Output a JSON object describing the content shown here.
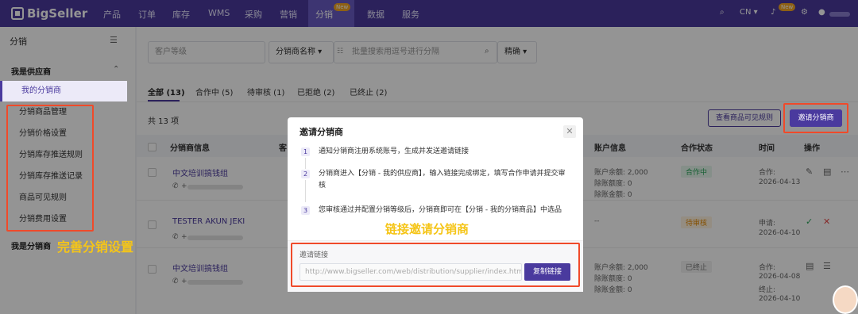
{
  "nav": {
    "logo": "BigSeller",
    "items": [
      "产品",
      "订单",
      "库存",
      "WMS",
      "采购",
      "营销",
      "分销",
      "数据",
      "服务"
    ],
    "new_badge": "New",
    "lang": "CN ▾",
    "right_badge": "New"
  },
  "sidebar": {
    "title": "分销",
    "group_supplier": "我是供应商",
    "items": [
      "我的分销商",
      "分销商品管理",
      "分销价格设置",
      "分销库存推送规则",
      "分销库存推送记录",
      "商品可见规则",
      "分销费用设置"
    ],
    "group_distributor": "我是分销商",
    "annotation": "完善分销设置"
  },
  "filters": {
    "level": "客户等级",
    "name_field": "分销商名称 ▾",
    "search_placeholder": "批量搜索用逗号进行分隔",
    "match": "精确 ▾"
  },
  "tabs": [
    "全部 (13)",
    "合作中 (5)",
    "待审核 (1)",
    "已拒绝 (2)",
    "已终止 (2)"
  ],
  "count_label": "共 13 项",
  "buttons": {
    "visible_rules": "查看商品可见规则",
    "invite": "邀请分销商"
  },
  "table": {
    "headers": [
      "分销商信息",
      "客",
      "账户信息",
      "合作状态",
      "时间",
      "操作"
    ],
    "rows": [
      {
        "name": "中文培训搞钱组",
        "phone": "+",
        "account": [
          "账户余额: 2,000",
          "除账额度: 0",
          "除账金额: 0"
        ],
        "status": "合作中",
        "time": [
          "合作:",
          "2026-04-13"
        ]
      },
      {
        "name": "TESTER AKUN JEKI",
        "phone": "+",
        "account": [
          "--"
        ],
        "status": "待审核",
        "time": [
          "申请:",
          "2026-04-10"
        ]
      },
      {
        "name": "中文培训搞钱组",
        "phone": "+",
        "account": [
          "账户余额: 2,000",
          "除账额度: 0",
          "除账金额: 0"
        ],
        "status": "已终止",
        "time": [
          "合作:",
          "2026-04-08",
          "终止:",
          "2026-04-10"
        ]
      }
    ]
  },
  "modal": {
    "title": "邀请分销商",
    "close": "✕",
    "steps": [
      {
        "num": "1",
        "text": "通知分销商注册系统账号，生成并发送邀请链接"
      },
      {
        "num": "2",
        "text": "分销商进入【分销 - 我的供应商】，输入链接完成绑定，填写合作申请并提交审核"
      },
      {
        "num": "3",
        "text": "您审核通过并配置分销等级后，分销商即可在【分销 - 我的分销商品】中选品"
      }
    ],
    "annotation": "链接邀请分销商",
    "link_label": "邀请链接",
    "link_value": "http://www.bigseller.com/web/distribution/supplier/index.htm?i",
    "copy_button": "复制链接"
  },
  "colors": {
    "brand": "#4a3a9e",
    "annotation": "#f5c518",
    "highlight": "#f04a2a"
  }
}
